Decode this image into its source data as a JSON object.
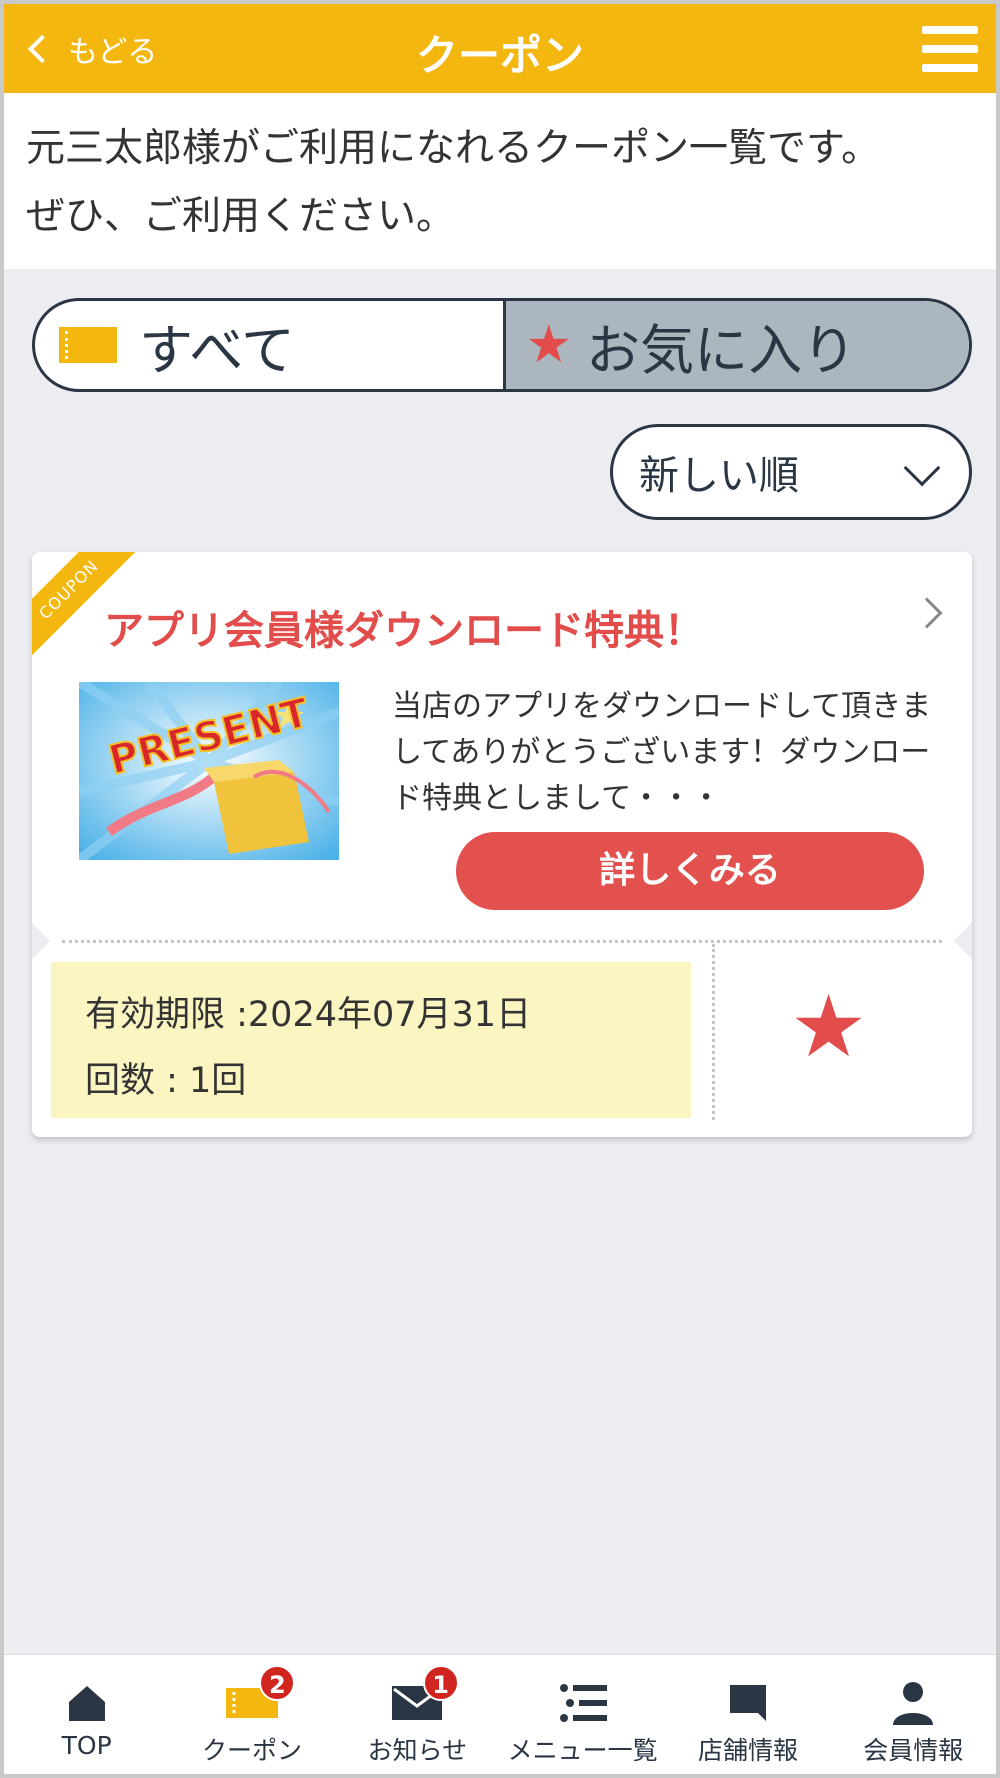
{
  "header": {
    "back_label": "もどる",
    "title": "クーポン"
  },
  "intro": {
    "line1": "元三太郎様がご利用になれるクーポン一覧です。",
    "line2": "ぜひ、ご利用ください。"
  },
  "filter_tabs": [
    {
      "label": "すべて",
      "icon": "ticket-icon",
      "selected": true
    },
    {
      "label": "お気に入り",
      "icon": "star-icon",
      "selected": false
    }
  ],
  "sort": {
    "selected": "新しい順"
  },
  "coupon": {
    "ribbon": "COUPON",
    "title": "アプリ会員様ダウンロード特典！",
    "image_text": "PRESENT",
    "description": "当店のアプリをダウンロードして頂きましてありがとうございます！ダウンロード特典としまして・・・",
    "detail_button": "詳しくみる",
    "expiry": "有効期限 :2024年07月31日",
    "count": "回数 : 1回",
    "favorited": true
  },
  "bottom_nav": [
    {
      "label": "TOP",
      "icon": "home-icon",
      "badge": ""
    },
    {
      "label": "クーポン",
      "icon": "coupon-icon",
      "badge": "2"
    },
    {
      "label": "お知らせ",
      "icon": "mail-icon",
      "badge": "1"
    },
    {
      "label": "メニュー一覧",
      "icon": "menu-list-icon",
      "badge": ""
    },
    {
      "label": "店舗情報",
      "icon": "store-icon",
      "badge": ""
    },
    {
      "label": "会員情報",
      "icon": "user-icon",
      "badge": ""
    }
  ],
  "colors": {
    "header": "#f3b70f",
    "accent_red": "#e24c4b",
    "navy": "#2b3645",
    "validity_bg": "#fbf5c2",
    "background": "#ebedf0"
  }
}
